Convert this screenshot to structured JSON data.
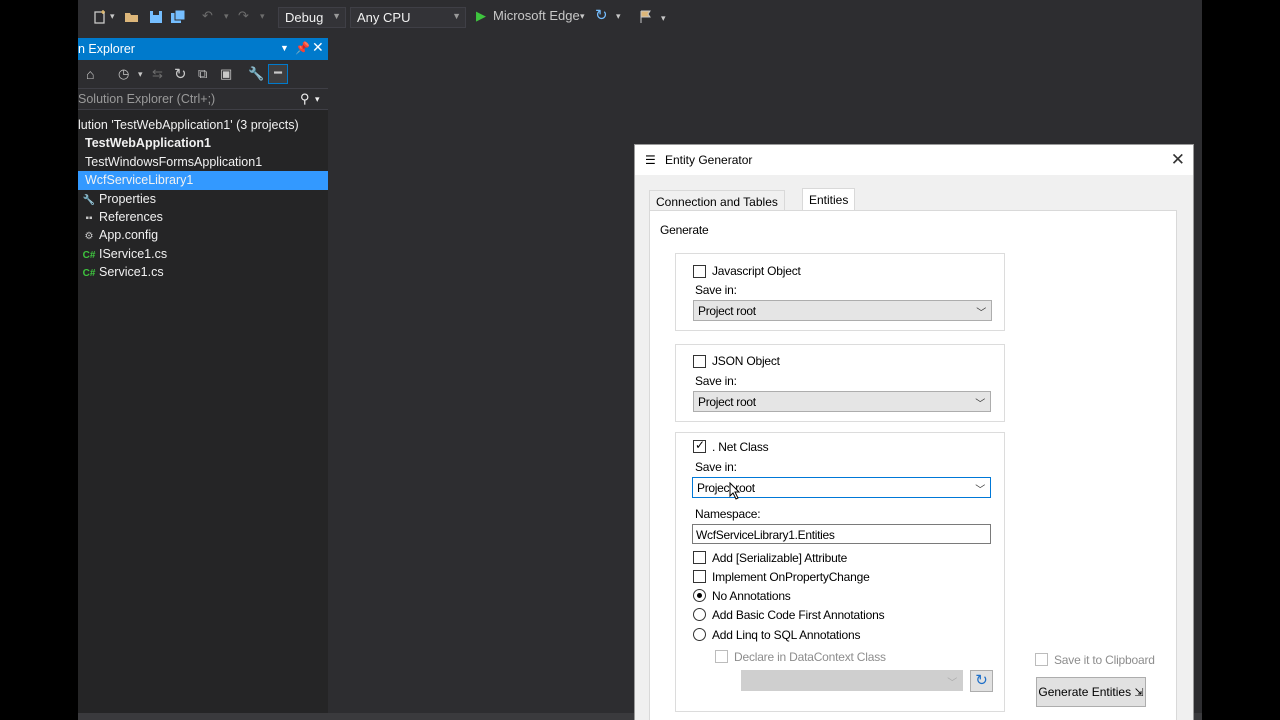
{
  "toolbar": {
    "config": "Debug",
    "platform": "Any CPU",
    "run_target": "Microsoft Edge"
  },
  "solution_explorer": {
    "title": "n Explorer",
    "search_placeholder": "Solution Explorer (Ctrl+;)",
    "tree": [
      {
        "label": "lution 'TestWebApplication1' (3 projects)",
        "icon": "solution-icon"
      },
      {
        "label": "TestWebApplication1",
        "icon": "project-icon",
        "bold": true
      },
      {
        "label": "TestWindowsFormsApplication1",
        "icon": "project-icon"
      },
      {
        "label": "WcfServiceLibrary1",
        "icon": "project-icon",
        "selected": true
      },
      {
        "label": "Properties",
        "icon": "wrench-icon"
      },
      {
        "label": "References",
        "icon": "references-icon"
      },
      {
        "label": "App.config",
        "icon": "config-icon"
      },
      {
        "label": "IService1.cs",
        "icon": "csharp-icon"
      },
      {
        "label": "Service1.cs",
        "icon": "csharp-icon"
      }
    ]
  },
  "dialog": {
    "title": "Entity Generator",
    "tabs": [
      "Connection and Tables",
      "Entities"
    ],
    "active_tab": "Entities",
    "generate_label": "Generate",
    "save_in_label": "Save in:",
    "js": {
      "label": "Javascript Object",
      "checked": false,
      "save_in": "Project root"
    },
    "json": {
      "label": "JSON Object",
      "checked": false,
      "save_in": "Project root"
    },
    "net": {
      "label": ". Net Class",
      "checked": true,
      "save_in": "Project root",
      "namespace_label": "Namespace:",
      "namespace": "WcfServiceLibrary1.Entities",
      "serializable": {
        "label": "Add [Serializable] Attribute",
        "checked": false
      },
      "property_change": {
        "label": "Implement OnPropertyChange",
        "checked": false
      },
      "annotations": [
        {
          "label": "No Annotations",
          "selected": true
        },
        {
          "label": "Add Basic Code First Annotations",
          "selected": false
        },
        {
          "label": "Add Linq to SQL Annotations",
          "selected": false
        }
      ],
      "datacontext": {
        "label": "Declare in DataContext Class",
        "checked": false,
        "disabled": true
      }
    },
    "clipboard": {
      "label": "Save it to Clipboard",
      "checked": false,
      "disabled": true
    },
    "generate_button": "Generate Entities"
  }
}
